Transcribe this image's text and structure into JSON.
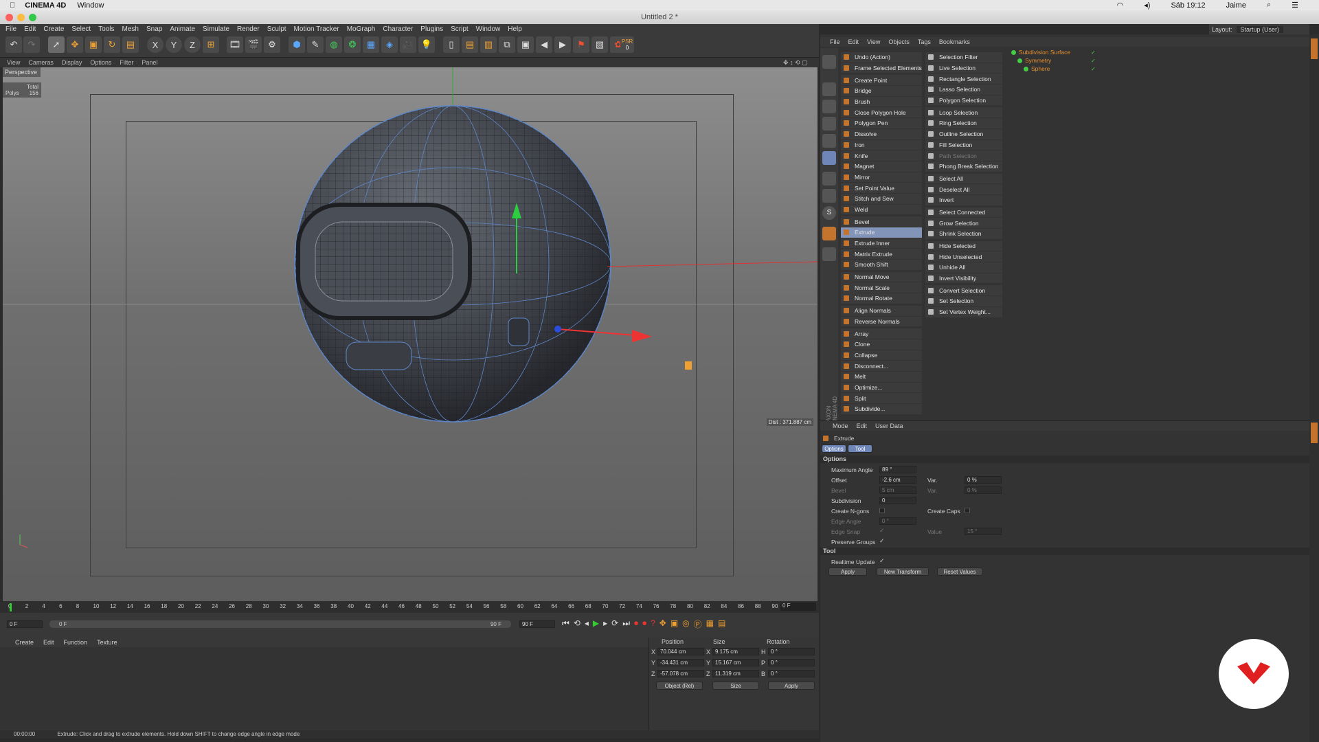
{
  "mac": {
    "app": "CINEMA 4D",
    "window": "Window",
    "clock": "Sáb 19:12",
    "user": "Jaime"
  },
  "title": "Untitled 2 *",
  "layout": {
    "label": "Layout:",
    "value": "Startup (User)"
  },
  "menu": [
    "File",
    "Edit",
    "Create",
    "Select",
    "Tools",
    "Mesh",
    "Snap",
    "Animate",
    "Simulate",
    "Render",
    "Sculpt",
    "Motion Tracker",
    "MoGraph",
    "Character",
    "Plugins",
    "Script",
    "Window",
    "Help"
  ],
  "toolbar": {
    "psr": "PSR",
    "psr_val": "0",
    "x": "X",
    "y": "Y",
    "z": "Z"
  },
  "vp_menu": [
    "View",
    "Cameras",
    "Display",
    "Options",
    "Filter",
    "Panel"
  ],
  "viewport": {
    "label": "Perspective",
    "hud_total": "Total",
    "hud_polys_label": "Polys",
    "hud_polys": "156",
    "dist": "Dist : 371.887 cm"
  },
  "timeline": {
    "ticks": [
      "0",
      "2",
      "4",
      "6",
      "8",
      "10",
      "12",
      "14",
      "16",
      "18",
      "20",
      "22",
      "24",
      "26",
      "28",
      "30",
      "32",
      "34",
      "36",
      "38",
      "40",
      "42",
      "44",
      "46",
      "48",
      "50",
      "52",
      "54",
      "56",
      "58",
      "60",
      "62",
      "64",
      "66",
      "68",
      "70",
      "72",
      "74",
      "76",
      "78",
      "80",
      "82",
      "84",
      "86",
      "88",
      "90"
    ],
    "current": "0 F"
  },
  "transport": {
    "start": "0 F",
    "range_start": "0 F",
    "range_end": "90 F",
    "end": "90 F"
  },
  "anim_menu": [
    "Create",
    "Edit",
    "Function",
    "Texture"
  ],
  "coords": {
    "h_pos": "Position",
    "h_size": "Size",
    "h_rot": "Rotation",
    "px": "70.044 cm",
    "py": "-34.431 cm",
    "pz": "-57.078 cm",
    "sx": "9.175 cm",
    "sy": "15.167 cm",
    "sz": "11.319 cm",
    "rh": "0 °",
    "rp": "0 °",
    "rb": "0 °",
    "mode": "Object (Rel)",
    "size_mode": "Size",
    "apply": "Apply",
    "lx": "X",
    "ly": "Y",
    "lz": "Z",
    "lsx": "X",
    "lsy": "Y",
    "lsz": "Z",
    "lh": "H",
    "lp": "P",
    "lb": "B"
  },
  "status": {
    "time": "00:00:00",
    "text": "Extrude: Click and drag to extrude elements. Hold down SHIFT to change edge angle in edge mode"
  },
  "obj_menu": [
    "File",
    "Edit",
    "View",
    "Objects",
    "Tags",
    "Bookmarks"
  ],
  "palette1": [
    {
      "label": "Undo (Action)"
    },
    {
      "label": "Frame Selected Elements"
    },
    {
      "gap": true
    },
    {
      "label": "Create Point"
    },
    {
      "label": "Bridge"
    },
    {
      "label": "Brush"
    },
    {
      "label": "Close Polygon Hole"
    },
    {
      "label": "Polygon Pen"
    },
    {
      "label": "Dissolve"
    },
    {
      "label": "Iron"
    },
    {
      "label": "Knife"
    },
    {
      "label": "Magnet"
    },
    {
      "label": "Mirror"
    },
    {
      "label": "Set Point Value"
    },
    {
      "label": "Stitch and Sew"
    },
    {
      "label": "Weld"
    },
    {
      "gap": true
    },
    {
      "label": "Bevel"
    },
    {
      "label": "Extrude",
      "sel": true
    },
    {
      "label": "Extrude Inner"
    },
    {
      "label": "Matrix Extrude"
    },
    {
      "label": "Smooth Shift"
    },
    {
      "gap": true
    },
    {
      "label": "Normal Move"
    },
    {
      "label": "Normal Scale"
    },
    {
      "label": "Normal Rotate"
    },
    {
      "gap": true
    },
    {
      "label": "Align Normals"
    },
    {
      "label": "Reverse Normals"
    },
    {
      "gap": true
    },
    {
      "label": "Array"
    },
    {
      "label": "Clone"
    },
    {
      "label": "Collapse"
    },
    {
      "label": "Disconnect..."
    },
    {
      "label": "Melt"
    },
    {
      "label": "Optimize..."
    },
    {
      "label": "Split"
    },
    {
      "label": "Subdivide..."
    }
  ],
  "palette2": [
    {
      "label": "Selection Filter"
    },
    {
      "label": "Live Selection"
    },
    {
      "label": "Rectangle Selection"
    },
    {
      "label": "Lasso Selection"
    },
    {
      "label": "Polygon Selection"
    },
    {
      "gap": true
    },
    {
      "label": "Loop Selection"
    },
    {
      "label": "Ring Selection"
    },
    {
      "label": "Outline Selection"
    },
    {
      "label": "Fill Selection"
    },
    {
      "label": "Path Selection",
      "dim": true
    },
    {
      "label": "Phong Break Selection"
    },
    {
      "gap": true
    },
    {
      "label": "Select All"
    },
    {
      "label": "Deselect All"
    },
    {
      "label": "Invert"
    },
    {
      "gap": true
    },
    {
      "label": "Select Connected"
    },
    {
      "label": "Grow Selection"
    },
    {
      "label": "Shrink Selection"
    },
    {
      "gap": true
    },
    {
      "label": "Hide Selected"
    },
    {
      "label": "Hide Unselected"
    },
    {
      "label": "Unhide All"
    },
    {
      "label": "Invert Visibility"
    },
    {
      "gap": true
    },
    {
      "label": "Convert Selection"
    },
    {
      "label": "Set Selection"
    },
    {
      "label": "Set Vertex Weight..."
    }
  ],
  "objects": [
    {
      "name": "Subdivision Surface",
      "indent": 0
    },
    {
      "name": "Symmetry",
      "indent": 1
    },
    {
      "name": "Sphere",
      "indent": 2
    }
  ],
  "attr": {
    "menu": [
      "Mode",
      "Edit",
      "User Data"
    ],
    "title": "Extrude",
    "tabs": [
      "Options",
      "Tool"
    ],
    "section_options": "Options",
    "max_angle_label": "Maximum Angle",
    "max_angle": "89 °",
    "offset_label": "Offset",
    "offset": "-2.6 cm",
    "var_label": "Var.",
    "var": "0 %",
    "bevel_label": "Bevel",
    "bevel": "5 cm",
    "var2_label": "Var.",
    "var2": "0 %",
    "subdiv_label": "Subdivision",
    "subdiv": "0",
    "ngons_label": "Create N-gons",
    "caps_label": "Create Caps",
    "edge_angle_label": "Edge Angle",
    "edge_angle": "0 °",
    "edge_snap_label": "Edge Snap",
    "value_label": "Value",
    "value": "15 °",
    "groups_label": "Preserve Groups",
    "section_tool": "Tool",
    "realtime_label": "Realtime Update",
    "apply": "Apply",
    "new_transform": "New Transform",
    "reset": "Reset Values"
  },
  "maxon": "MAXON CINEMA 4D"
}
